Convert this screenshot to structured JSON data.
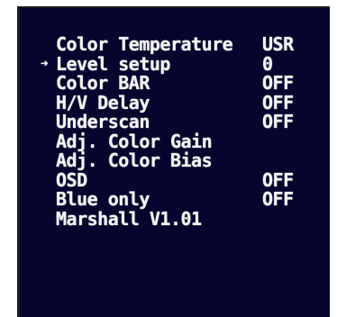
{
  "osd": {
    "selected_index": 1,
    "cursor_icon": "arrow-right-icon",
    "cursor_glyph": "➜",
    "items": [
      {
        "label": "Color Temperature",
        "value": "USR"
      },
      {
        "label": "Level setup",
        "value": "0"
      },
      {
        "label": "Color BAR",
        "value": "OFF"
      },
      {
        "label": "H/V Delay",
        "value": "OFF"
      },
      {
        "label": "Underscan",
        "value": "OFF"
      },
      {
        "label": "Adj. Color Gain",
        "value": ""
      },
      {
        "label": "Adj. Color Bias",
        "value": ""
      },
      {
        "label": "OSD",
        "value": "OFF"
      },
      {
        "label": "Blue only",
        "value": "OFF"
      },
      {
        "label": "Marshall V1.01",
        "value": ""
      }
    ]
  },
  "colors": {
    "screen_background": "#05052e",
    "text": "#f4f4f4"
  }
}
